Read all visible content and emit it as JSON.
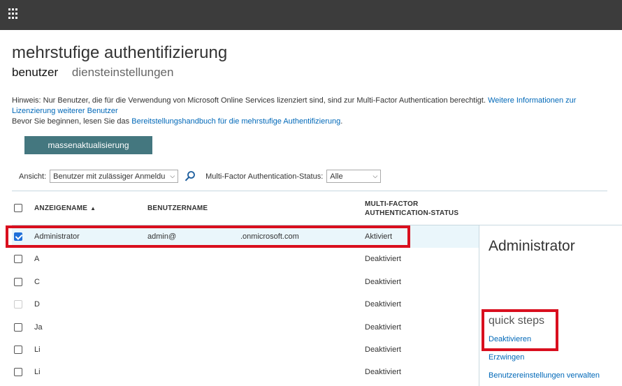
{
  "page": {
    "title": "mehrstufige authentifizierung",
    "tabs": [
      {
        "label": "benutzer",
        "active": true
      },
      {
        "label": "diensteinstellungen",
        "active": false
      }
    ]
  },
  "hint": {
    "text": "Hinweis: Nur Benutzer, die für die Verwendung von Microsoft Online Services lizenziert sind, sind zur Multi-Factor Authentication berechtigt. ",
    "link1": "Weitere Informationen zur Lizenzierung weiterer Benutzer",
    "line2_prefix": "Bevor Sie beginnen, lesen Sie das ",
    "link2": "Bereitstellungshandbuch für die mehrstufige Authentifizierung",
    "line2_suffix": "."
  },
  "bulk_update_label": "massenaktualisierung",
  "filters": {
    "view_label": "Ansicht:",
    "view_value": "Benutzer mit zulässiger Anmeldu",
    "status_label": "Multi-Factor Authentication-Status:",
    "status_value": "Alle"
  },
  "table": {
    "columns": {
      "display_name": "ANZEIGENAME",
      "user_name": "BENUTZERNAME",
      "mfa_status_line1": "MULTI-FACTOR",
      "mfa_status_line2": "AUTHENTICATION-STATUS"
    },
    "rows": [
      {
        "name": "Administrator",
        "user": "admin@",
        "domain": ".onmicrosoft.com",
        "status": "Aktiviert",
        "checked": true,
        "disabled": false
      },
      {
        "name": "A",
        "user": "",
        "domain": "",
        "status": "Deaktiviert",
        "checked": false,
        "disabled": false
      },
      {
        "name": "C",
        "user": "",
        "domain": "",
        "status": "Deaktiviert",
        "checked": false,
        "disabled": false
      },
      {
        "name": "D",
        "user": "",
        "domain": "",
        "status": "Deaktiviert",
        "checked": false,
        "disabled": true
      },
      {
        "name": "Ja",
        "user": "",
        "domain": "",
        "status": "Deaktiviert",
        "checked": false,
        "disabled": false
      },
      {
        "name": "Li",
        "user": "",
        "domain": "",
        "status": "Deaktiviert",
        "checked": false,
        "disabled": false
      },
      {
        "name": "Li",
        "user": "",
        "domain": "",
        "status": "Deaktiviert",
        "checked": false,
        "disabled": false
      }
    ]
  },
  "detail_panel": {
    "title": "Administrator",
    "quick_steps_title": "quick steps",
    "links": [
      "Deaktivieren",
      "Erzwingen",
      "Benutzereinstellungen verwalten"
    ]
  },
  "colors": {
    "topbar": "#3c3c3c",
    "button": "#44777f",
    "link": "#0068b8",
    "highlight": "#d90f1e",
    "selected_row": "#eaf6fb"
  },
  "icons": [
    "app-launcher-icon",
    "search-icon",
    "sort-ascending-icon",
    "chevron-down-icon"
  ]
}
